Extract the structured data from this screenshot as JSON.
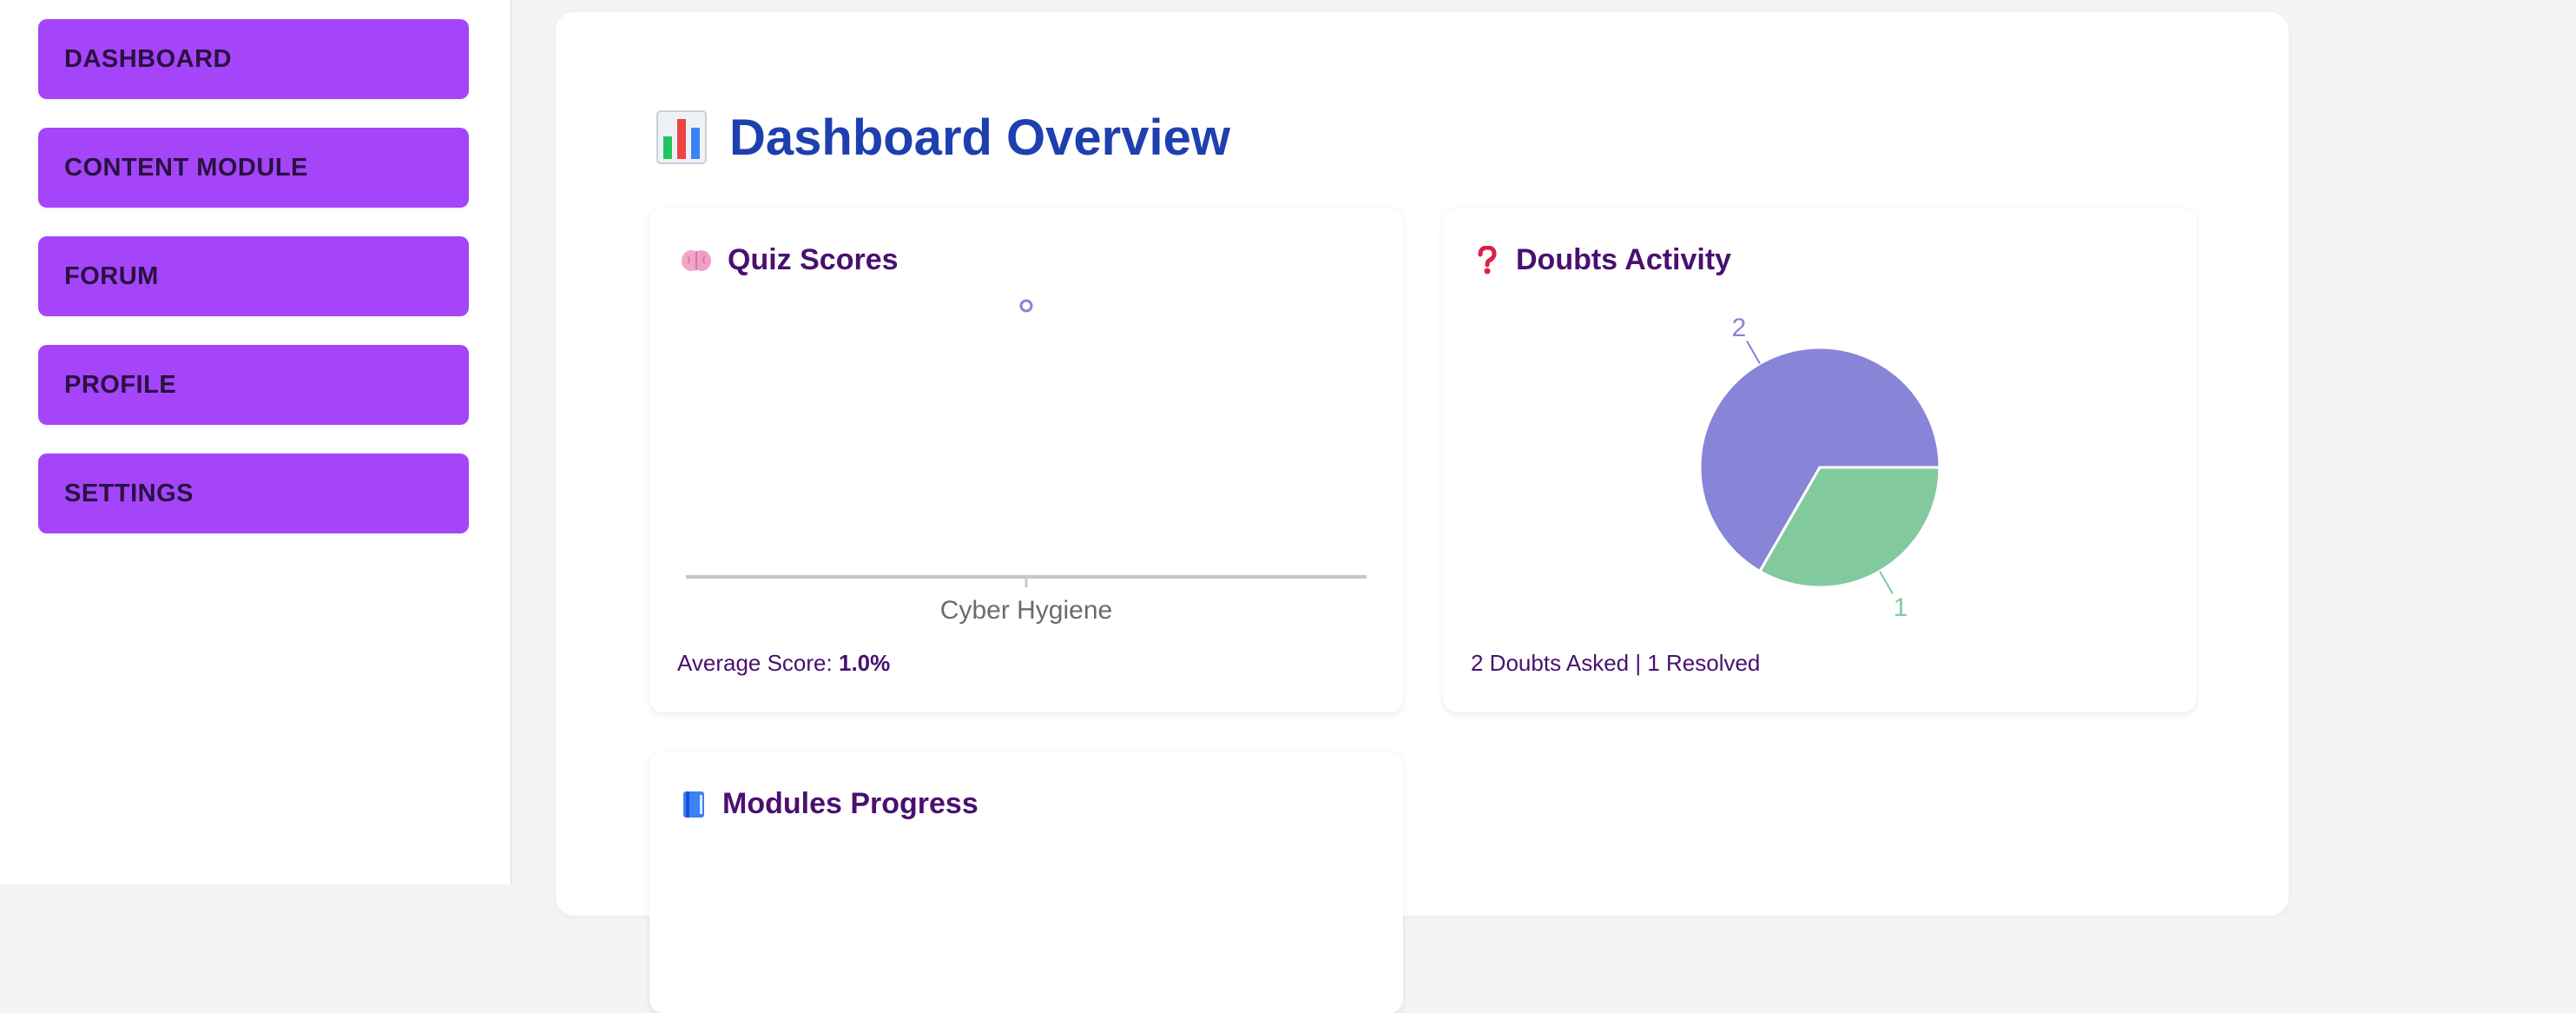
{
  "sidebar": {
    "items": [
      {
        "label": "DASHBOARD"
      },
      {
        "label": "CONTENT MODULE"
      },
      {
        "label": "FORUM"
      },
      {
        "label": "PROFILE"
      },
      {
        "label": "SETTINGS"
      }
    ]
  },
  "main": {
    "title": "Dashboard Overview",
    "title_icon": "bar-chart-icon",
    "cards": {
      "quiz": {
        "title": "Quiz Scores",
        "icon": "brain-icon",
        "footer_label": "Average Score:",
        "footer_value": "1.0%"
      },
      "doubts": {
        "title": "Doubts Activity",
        "icon": "question-mark-icon",
        "footer_text": "2 Doubts Asked | 1 Resolved"
      },
      "modules": {
        "title": "Modules Progress",
        "icon": "book-icon"
      }
    }
  },
  "chart_data": [
    {
      "type": "scatter",
      "title": "Quiz Scores",
      "categories": [
        "Cyber Hygiene"
      ],
      "values": [
        1.0
      ],
      "color": "#8884d8"
    },
    {
      "type": "pie",
      "title": "Doubts Activity",
      "slices": [
        {
          "value": 2,
          "label": "2",
          "color": "#8884d8"
        },
        {
          "value": 1,
          "label": "1",
          "color": "#82ca9d"
        }
      ]
    }
  ],
  "colors": {
    "nav_bg": "#a445fa",
    "title_blue": "#1e40af",
    "card_title": "#4a1070",
    "pie_purple": "#8884d8",
    "pie_green": "#82ca9d"
  }
}
